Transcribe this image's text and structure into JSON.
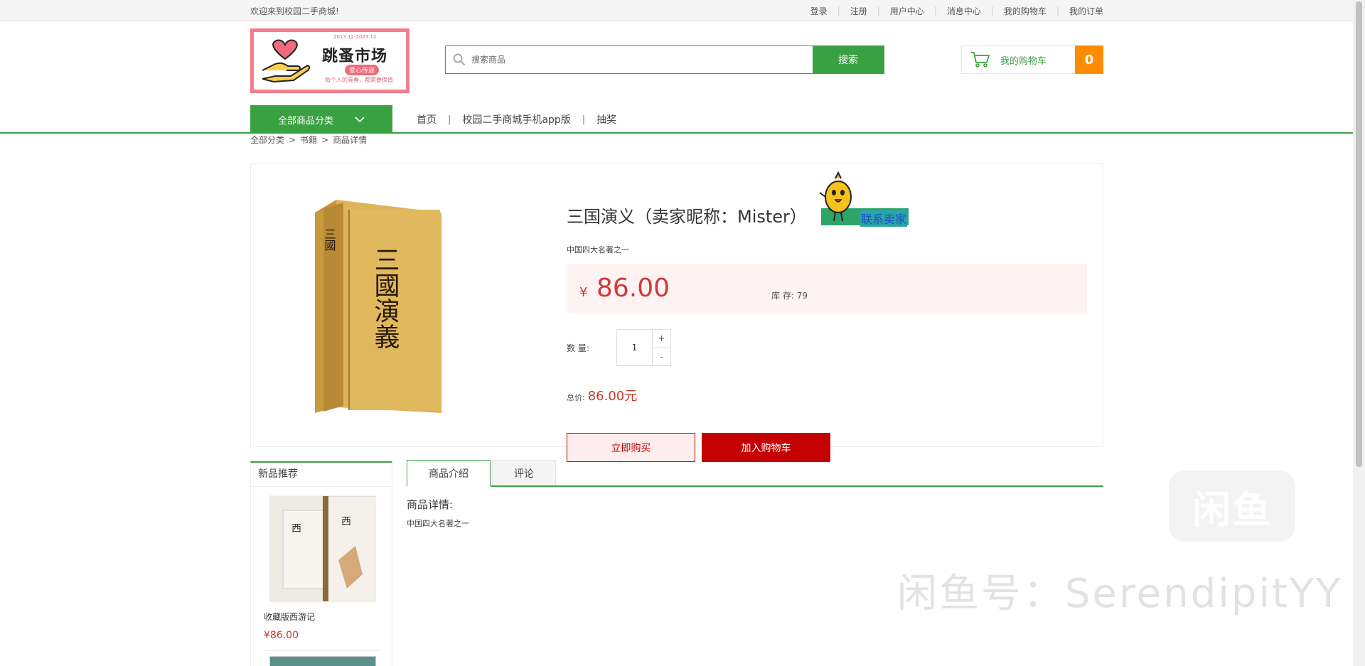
{
  "topbar": {
    "welcome": "欢迎来到校园二手商城!",
    "links": [
      "登录",
      "注册",
      "用户中心",
      "消息中心",
      "我的购物车",
      "我的订单"
    ]
  },
  "logo": {
    "title": "跳蚤市场",
    "badge": "爱心传递",
    "subtitle": "每个人的青春，都需要保值",
    "topline": "2013.12-2023.12"
  },
  "search": {
    "placeholder": "搜索商品",
    "button": "搜索"
  },
  "cart": {
    "label": "我的购物车",
    "count": "0"
  },
  "nav": {
    "all_categories": "全部商品分类",
    "links": [
      "首页",
      "校园二手商城手机app版",
      "抽奖"
    ]
  },
  "breadcrumb": [
    "全部分类",
    "书籍",
    "商品详情"
  ],
  "product": {
    "title": "三国演义（卖家昵称：Mister）",
    "contact": "联系卖家",
    "description": "中国四大名著之一",
    "currency": "¥",
    "price": "86.00",
    "stock_label": "库 存:",
    "stock": "79",
    "qty_label": "数 量:",
    "qty": "1",
    "plus": "+",
    "minus": "-",
    "total_label": "总价:",
    "total": "86.00元",
    "buy_now": "立即购买",
    "add_to_cart": "加入购物车",
    "book_cover_text": "三國演義"
  },
  "sidebar": {
    "heading": "新品推荐",
    "items": [
      {
        "name": "收藏版西游记",
        "price": "¥86.00"
      }
    ]
  },
  "tabs": {
    "items": [
      "商品介绍",
      "评论"
    ],
    "detail_title": "商品详情:",
    "detail_text": "中国四大名著之一"
  },
  "watermark": {
    "logo": "闲鱼",
    "text": "闲鱼号：SerendipitYY"
  },
  "colors": {
    "brand_green": "#3aa142",
    "price_red": "#d0393a",
    "cart_orange": "#ff8c00",
    "button_red": "#c40000"
  }
}
